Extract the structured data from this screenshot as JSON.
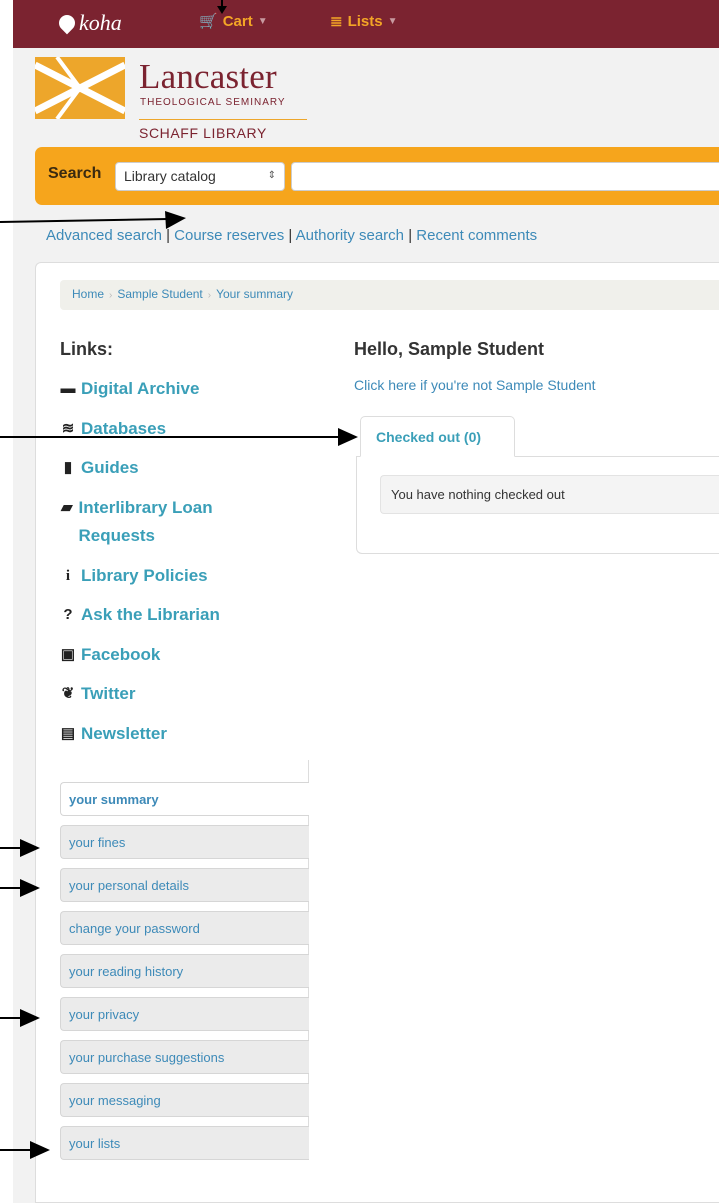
{
  "topbar": {
    "brand": "koha",
    "cart_label": "Cart",
    "lists_label": "Lists"
  },
  "logo": {
    "name": "Lancaster",
    "subtitle": "THEOLOGICAL SEMINARY",
    "library": "SCHAFF LIBRARY"
  },
  "search": {
    "label": "Search",
    "select_value": "Library catalog",
    "input_value": ""
  },
  "links_row": {
    "advanced": "Advanced search",
    "course": "Course reserves",
    "authority": "Authority search",
    "comments": "Recent comments",
    "separator": "|"
  },
  "breadcrumb": {
    "home": "Home",
    "student": "Sample Student",
    "current": "Your summary"
  },
  "sidebar": {
    "title": "Links:",
    "items": [
      {
        "label": "Digital Archive",
        "icon": "archive-icon"
      },
      {
        "label": "Databases",
        "icon": "database-icon"
      },
      {
        "label": "Guides",
        "icon": "bookmark-icon"
      },
      {
        "label": "Interlibrary Loan Requests",
        "icon": "book-icon"
      },
      {
        "label": "Library Policies",
        "icon": "info-icon"
      },
      {
        "label": "Ask the Librarian",
        "icon": "question-icon"
      },
      {
        "label": "Facebook",
        "icon": "facebook-icon"
      },
      {
        "label": "Twitter",
        "icon": "twitter-icon"
      },
      {
        "label": "Newsletter",
        "icon": "newspaper-icon"
      }
    ]
  },
  "main": {
    "greeting": "Hello, Sample Student",
    "not_you": "Click here if you're not Sample Student",
    "tab_label": "Checked out (0)",
    "empty_message": "You have nothing checked out"
  },
  "user_menu": [
    "your summary",
    "your fines",
    "your personal details",
    "change your password",
    "your reading history",
    "your privacy",
    "your purchase suggestions",
    "your messaging",
    "your lists"
  ],
  "colors": {
    "topbar": "#7b2330",
    "accent": "#f6a51c",
    "link": "#3a9fb8"
  }
}
